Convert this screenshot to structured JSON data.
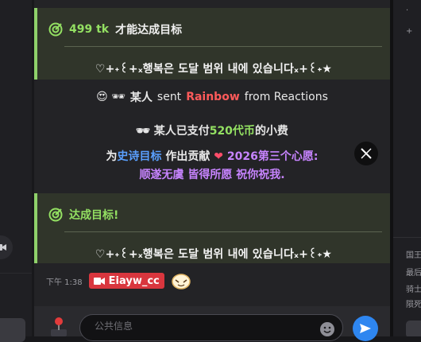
{
  "goal_one": {
    "amount": "499 tk",
    "label": "才能达成目标",
    "message": "♡+˖꒰ּ+ₓ행복은 도달 범위 내에 있습니다ₓ+꒰ּ˖★"
  },
  "reaction": {
    "prefix_emoji": "😍 🕶",
    "user": "某人",
    "verb": "sent",
    "gift": "Rainbow",
    "suffix": "from Reactions"
  },
  "tip": {
    "user_emoji": "🕶",
    "user": "某人",
    "text_before": "已支付",
    "amount": "520代币",
    "text_after": "的小费",
    "line2_a": "为",
    "line2_goal": "史诗目标",
    "line2_b": "作出贡献",
    "line2_heart": "❤",
    "line2_c": "2026第三个心愿:",
    "line3": "顺遂无虞 皆得所愿 祝你祝我."
  },
  "goal_two": {
    "label": "达成目标!",
    "message": "♡+˖꒰ּ+ₓ행복은 도달 범위 내에 있습니다ₓ+꒰ּ˖★"
  },
  "message": {
    "time": "下午 1:38",
    "username": "Eiayw_cc"
  },
  "input": {
    "placeholder": "公共信息"
  },
  "right_panel": {
    "lines": [
      "国王",
      "最后",
      "骑士",
      "陨死"
    ]
  },
  "icons": {
    "goal": "target-icon",
    "x": "x-logo-icon",
    "camera": "camera-icon",
    "joystick": "joystick-icon",
    "emoji": "smile-icon",
    "send": "send-icon"
  },
  "colors": {
    "accent_green": "#93e062",
    "goal_bg": "#30352a",
    "gift_red": "#ff5a5a",
    "badge_red": "#d9363e",
    "blue": "#5aa0ff",
    "purple": "#c784ff",
    "send_blue": "#2e86f0"
  }
}
